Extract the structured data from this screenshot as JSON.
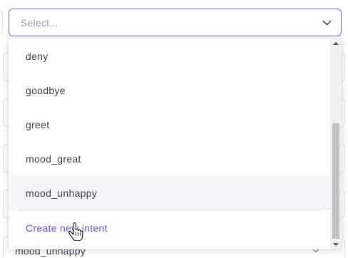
{
  "select": {
    "placeholder": "Select..."
  },
  "menu": {
    "items": [
      {
        "label": "deny"
      },
      {
        "label": "goodbye"
      },
      {
        "label": "greet"
      },
      {
        "label": "mood_great"
      },
      {
        "label": "mood_unhappy"
      }
    ],
    "create_label": "Create new intent"
  },
  "background": {
    "bottom_field_value": "mood_unhappy"
  },
  "icons": {
    "chevron": "chevron-down-icon",
    "cursor": "hand-pointer-icon"
  },
  "colors": {
    "accent": "#6c63e0",
    "create_link": "#5a55d6",
    "hover_row": "#f4f5f9",
    "placeholder": "#9a9cb4"
  }
}
